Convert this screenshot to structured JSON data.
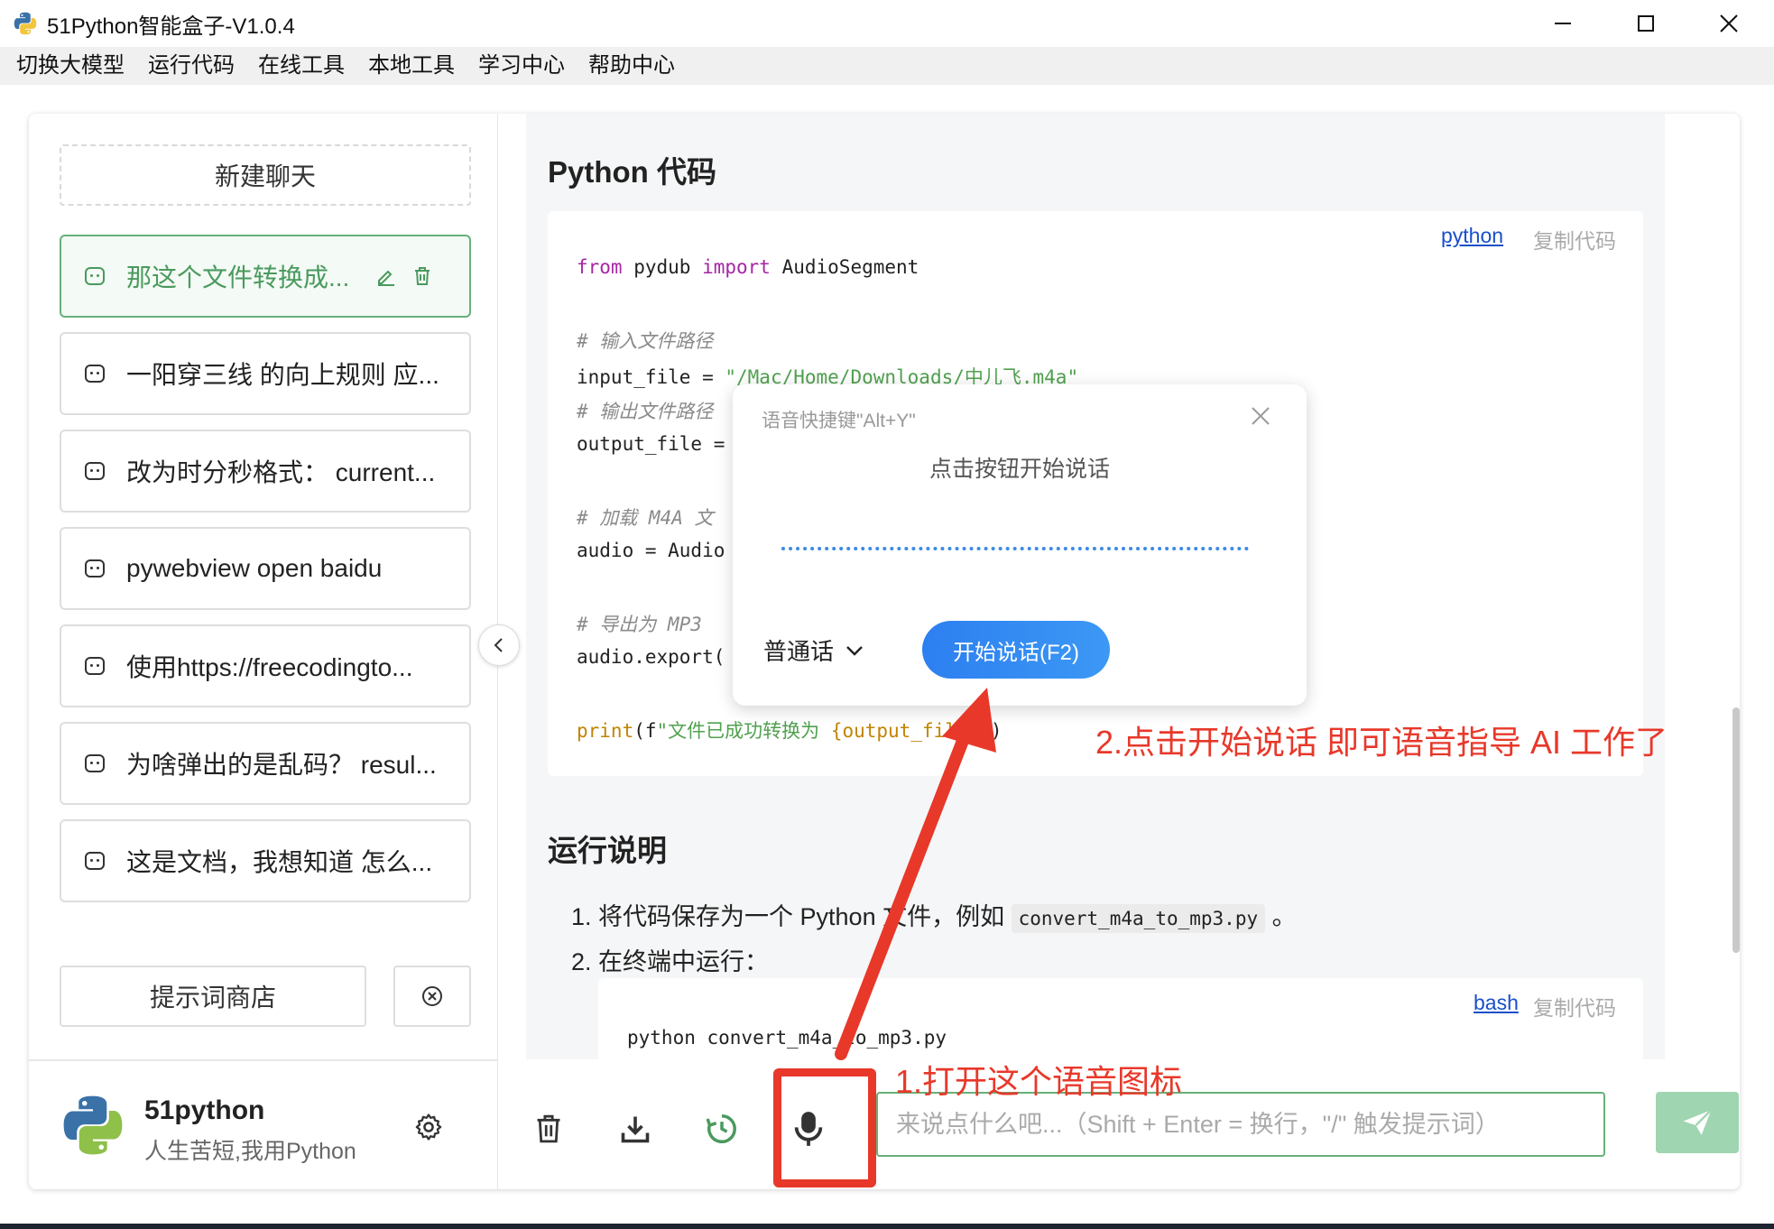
{
  "window": {
    "title": "51Python智能盒子-V1.0.4"
  },
  "menu": [
    "切换大模型",
    "运行代码",
    "在线工具",
    "本地工具",
    "学习中心",
    "帮助中心"
  ],
  "sidebar": {
    "new_chat": "新建聊天",
    "chats": [
      "那这个文件转换成...",
      "一阳穿三线 的向上规则 应...",
      "改为时分秒格式： current...",
      "pywebview open baidu",
      "使用https://freecodingto...",
      "为啥弹出的是乱码？ resul...",
      "这是文档，我想知道 怎么..."
    ],
    "prompt_shop": "提示词商店",
    "profile": {
      "name": "51python",
      "motto": "人生苦短,我用Python"
    }
  },
  "content": {
    "heading_code": "Python 代码",
    "code_lang": "python",
    "copy_label": "复制代码",
    "heading_run": "运行说明",
    "step1_pre": "1. 将代码保存为一个 Python 文件，例如",
    "step1_code": "convert_m4a_to_mp3.py",
    "step1_post": "。",
    "step2": "2. 在终端中运行：",
    "bash_lang": "bash",
    "bash_line": "python convert_m4a_to_mp3.py"
  },
  "input": {
    "placeholder": "来说点什么吧...（Shift + Enter = 换行，\"/\" 触发提示词）"
  },
  "voice_dialog": {
    "shortcut": "语音快捷键\"Alt+Y\"",
    "hint": "点击按钮开始说话",
    "language": "普通话",
    "start_button": "开始说话(F2)"
  },
  "annotations": {
    "step1": "1.打开这个语音图标",
    "step2": "2.点击开始说话 即可语音指导 AI 工作了"
  },
  "colors": {
    "accent_green": "#67b07b",
    "annotation_red": "#e8382a",
    "voice_blue": "#2d7ff0"
  }
}
